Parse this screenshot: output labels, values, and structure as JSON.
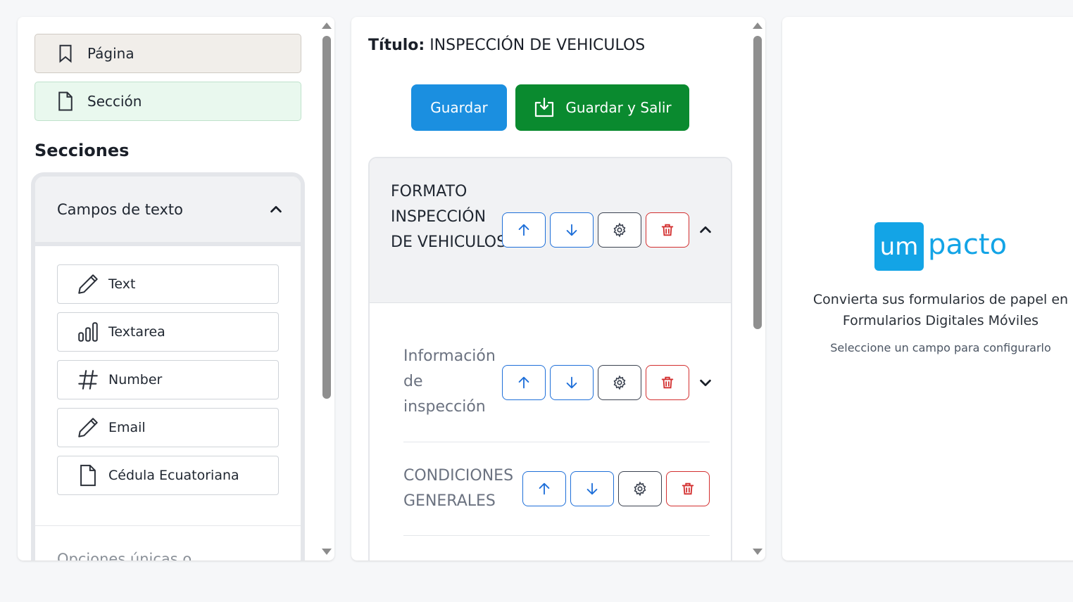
{
  "left_panel": {
    "type_cards": {
      "pagina": {
        "label": "Página",
        "icon": "bookmark-icon"
      },
      "seccion": {
        "label": "Sección",
        "icon": "file-icon"
      }
    },
    "secciones_heading": "Secciones",
    "accordion": {
      "title": "Campos de texto",
      "expanded": true,
      "fields": [
        {
          "label": "Text",
          "icon": "pencil-icon"
        },
        {
          "label": "Textarea",
          "icon": "bar-chart-icon"
        },
        {
          "label": "Number",
          "icon": "hash-icon"
        },
        {
          "label": "Email",
          "icon": "pencil-icon"
        },
        {
          "label": "Cédula Ecuatoriana",
          "icon": "file-icon"
        }
      ],
      "next_group_label": "Opciones únicas o"
    }
  },
  "middle_panel": {
    "titulo_label": "Título:",
    "titulo_value": "INSPECCIÓN DE VEHICULOS",
    "buttons": {
      "guardar": "Guardar",
      "guardar_salir": "Guardar y Salir"
    },
    "form": {
      "title": "FORMATO INSPECCIÓN DE VEHICULOS",
      "sections": [
        {
          "title": "Información de inspección"
        },
        {
          "title": "CONDICIONES GENERALES"
        }
      ]
    }
  },
  "right_panel": {
    "logo_um": "um",
    "logo_pacto": "pacto",
    "tagline_line1": "Convierta sus formularios de papel en",
    "tagline_line2": "Formularios Digitales Móviles",
    "hint": "Seleccione un campo para configurarlo"
  },
  "colors": {
    "primary_blue": "#1b8fe0",
    "success_green": "#0a8a2f",
    "danger_red": "#d32f2f",
    "brand_cyan": "#13a4e6"
  }
}
